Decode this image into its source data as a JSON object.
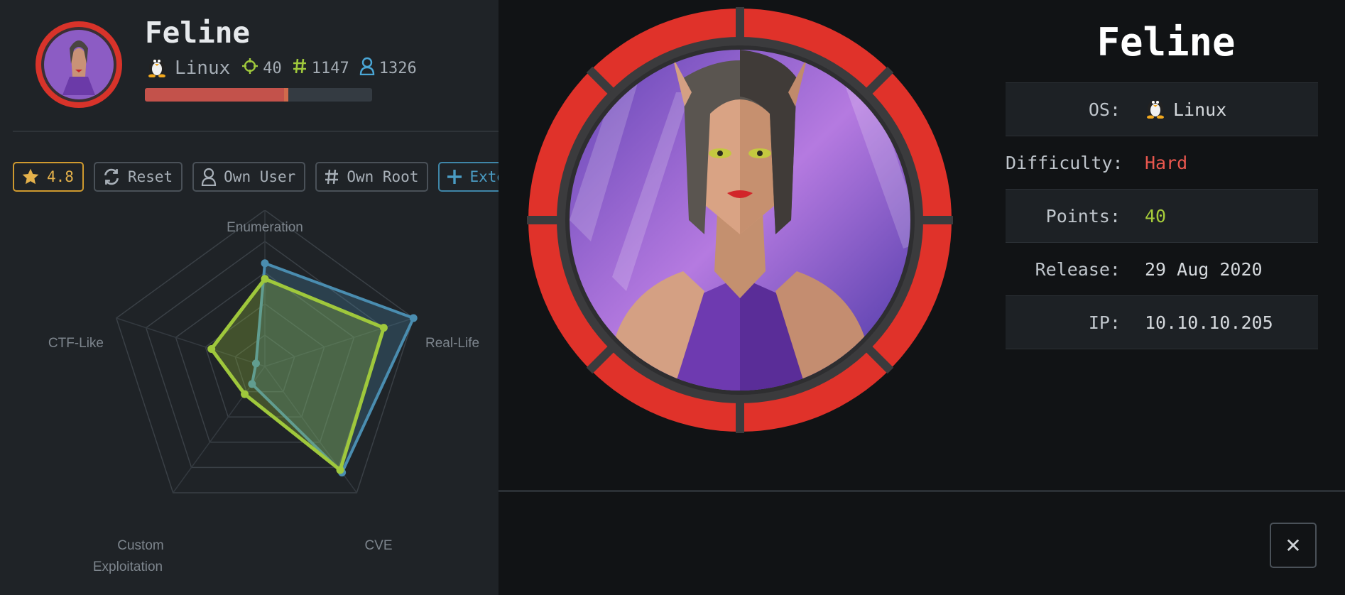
{
  "machine": {
    "name": "Feline",
    "os": "Linux",
    "points": "40",
    "root_owns": "1147",
    "user_owns": "1326",
    "progress_fraction": 0.63
  },
  "buttons": {
    "rating": "4.8",
    "reset": "Reset",
    "own_user": "Own User",
    "own_root": "Own Root",
    "external": "Exten"
  },
  "radar": {
    "axes": [
      "Enumeration",
      "Real-Life",
      "CVE",
      "Custom Exploitation",
      "CTF-Like"
    ],
    "axis_label_lines": {
      "enumeration": "Enumeration",
      "real_life": "Real-Life",
      "cve": "CVE",
      "custom_1": "Custom",
      "custom_2": "Exploitation",
      "ctf": "CTF-Like"
    },
    "max": 5,
    "series": [
      {
        "values": [
          3.3,
          5.0,
          4.2,
          0.7,
          0.3
        ],
        "color": "#4a8db0"
      },
      {
        "values": [
          2.8,
          4.0,
          4.1,
          1.1,
          1.8
        ],
        "color": "#9fc83c"
      }
    ]
  },
  "modal": {
    "title": "Feline",
    "os_label": "OS:",
    "os_value": "Linux",
    "difficulty_label": "Difficulty:",
    "difficulty_value": "Hard",
    "points_label": "Points:",
    "points_value": "40",
    "release_label": "Release:",
    "release_value": "29 Aug 2020",
    "ip_label": "IP:",
    "ip_value": "10.10.10.205",
    "close": "✕"
  },
  "colors": {
    "accent_green": "#9fc83c",
    "accent_blue": "#4a8db0",
    "hard_red": "#e9574e",
    "rating_gold": "#e4b14b",
    "progress_red": "#c3524b"
  },
  "icons": [
    "penguin-icon",
    "target-icon",
    "hash-icon",
    "user-icon",
    "star-icon",
    "refresh-icon",
    "plus-icon",
    "close-icon"
  ]
}
